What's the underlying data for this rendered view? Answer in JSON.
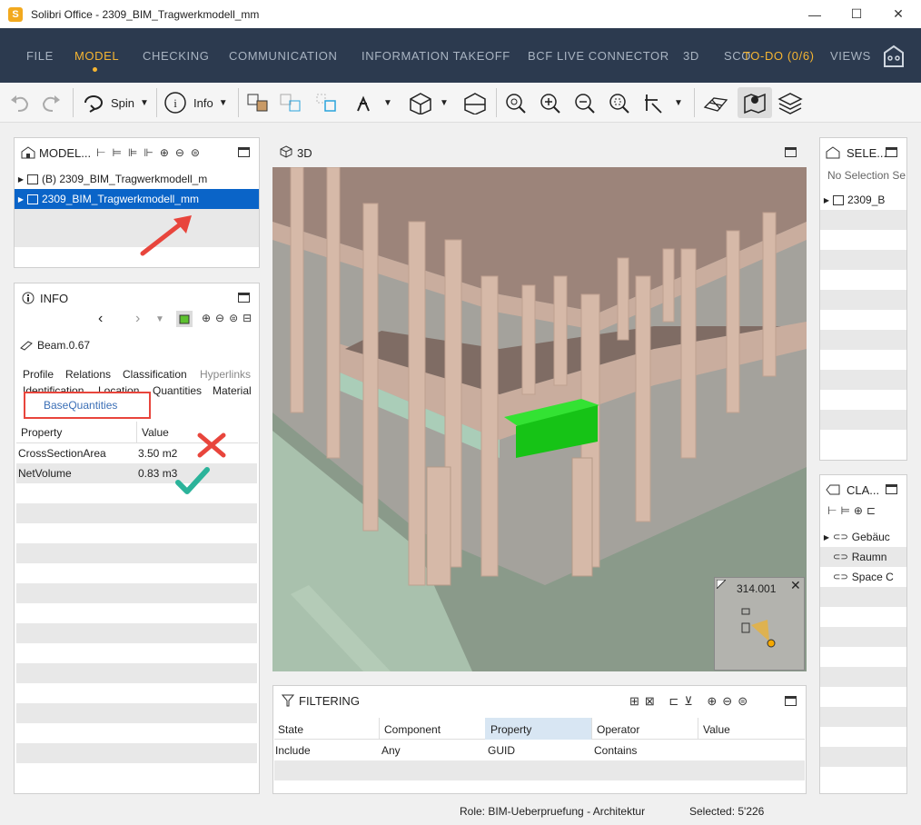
{
  "window": {
    "title": "Solibri Office - 2309_BIM_Tragwerkmodell_mm",
    "app_icon_letter": "S",
    "minimize": "—",
    "maximize": "☐",
    "close": "✕"
  },
  "menu": {
    "items": [
      "FILE",
      "MODEL",
      "CHECKING",
      "COMMUNICATION",
      "INFORMATION TAKEOFF",
      "BCF LIVE CONNECTOR",
      "3D",
      "SCO",
      "TO-DO (0/6)",
      "VIEWS"
    ],
    "active": "MODEL"
  },
  "toolbar": {
    "spin_label": "Spin",
    "info_label": "Info"
  },
  "model_panel": {
    "title": "MODEL...",
    "rows": [
      {
        "label": "(B) 2309_BIM_Tragwerkmodell_m",
        "selected": false
      },
      {
        "label": "2309_BIM_Tragwerkmodell_mm",
        "selected": true
      }
    ]
  },
  "info_panel": {
    "title": "INFO",
    "element_name": "Beam.0.67",
    "tabs_row1": [
      "Profile",
      "Relations",
      "Classification",
      "Hyperlinks"
    ],
    "tabs_row2": [
      "Identification",
      "Location",
      "Quantities",
      "Material"
    ],
    "active_tab": "BaseQuantities",
    "columns": [
      "Property",
      "Value"
    ],
    "rows": [
      {
        "property": "CrossSectionArea",
        "value": "3.50 m2"
      },
      {
        "property": "NetVolume",
        "value": "0.83 m3"
      }
    ]
  },
  "view3d": {
    "title": "3D",
    "minimap_label": "314.001"
  },
  "selection_panel": {
    "title": "SELE...",
    "empty_text": "No Selection Se",
    "rows": [
      "2309_B"
    ]
  },
  "classification_panel": {
    "title": "CLA...",
    "rows": [
      "Gebäuc",
      "Raumn",
      "Space C"
    ]
  },
  "filtering_panel": {
    "title": "FILTERING",
    "columns": [
      "State",
      "Component",
      "Property",
      "Operator",
      "Value"
    ],
    "rows": [
      {
        "state": "Include",
        "component": "Any",
        "property": "GUID",
        "operator": "Contains",
        "value": ""
      }
    ]
  },
  "status": {
    "role": "Role: BIM-Ueberpruefung - Architektur",
    "selected": "Selected: 5'226"
  },
  "colors": {
    "menu_bg": "#2c3a4f",
    "accent": "#f5b532",
    "selection": "#0a64c8",
    "beam_highlight": "#22cc22",
    "arrow_red": "#e8453c",
    "check_teal": "#2bb39a"
  }
}
